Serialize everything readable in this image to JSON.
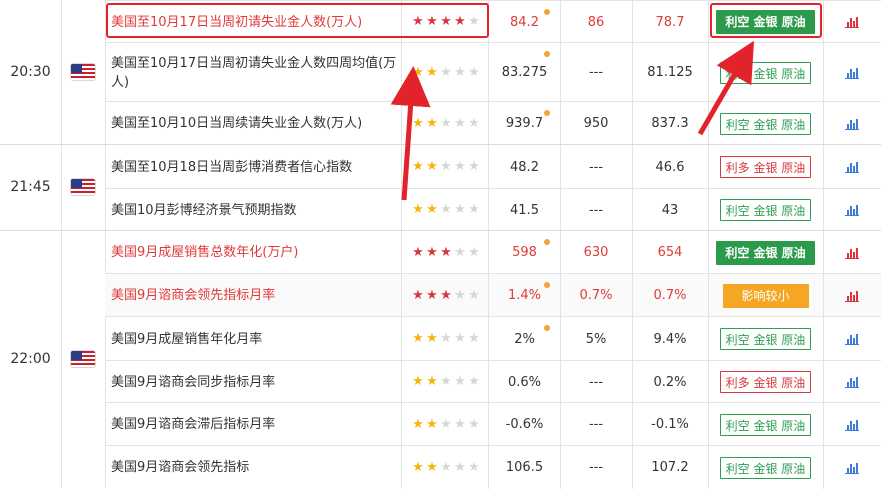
{
  "calendar": {
    "groups": [
      {
        "time": "20:30",
        "country_icon": "us-flag-icon",
        "rows": [
          {
            "name": "美国至10月17日当周初请失业金人数(万人)",
            "stars": 4,
            "star_color": "red",
            "highlight": true,
            "actual": "84.2",
            "actual_dot": true,
            "forecast": "86",
            "previous": "78.7",
            "effect": "利空 金银 原油",
            "effect_style": "green-filled",
            "chart_icon": "bar-chart-icon",
            "chart_color": "red"
          },
          {
            "name": "美国至10月17日当周初请失业金人数四周均值(万人)",
            "stars": 2,
            "star_color": "yellow",
            "highlight": false,
            "actual": "83.275",
            "actual_dot": true,
            "forecast": "---",
            "previous": "81.125",
            "effect": "利空 金银 原油",
            "effect_style": "green-outline",
            "chart_icon": "bar-chart-icon",
            "chart_color": "blue"
          },
          {
            "name": "美国至10月10日当周续请失业金人数(万人)",
            "stars": 2,
            "star_color": "yellow",
            "highlight": false,
            "actual": "939.7",
            "actual_dot": true,
            "forecast": "950",
            "previous": "837.3",
            "effect": "利空 金银 原油",
            "effect_style": "green-outline",
            "chart_icon": "bar-chart-icon",
            "chart_color": "blue"
          }
        ]
      },
      {
        "time": "21:45",
        "country_icon": "us-flag-icon",
        "rows": [
          {
            "name": "美国至10月18日当周彭博消费者信心指数",
            "stars": 2,
            "star_color": "yellow",
            "highlight": false,
            "actual": "48.2",
            "actual_dot": false,
            "forecast": "---",
            "previous": "46.6",
            "effect": "利多 金银 原油",
            "effect_style": "red-outline",
            "chart_icon": "bar-chart-icon",
            "chart_color": "blue"
          },
          {
            "name": "美国10月彭博经济景气预期指数",
            "stars": 2,
            "star_color": "yellow",
            "highlight": false,
            "actual": "41.5",
            "actual_dot": false,
            "forecast": "---",
            "previous": "43",
            "effect": "利空 金银 原油",
            "effect_style": "green-outline",
            "chart_icon": "bar-chart-icon",
            "chart_color": "blue"
          }
        ]
      },
      {
        "time": "22:00",
        "country_icon": "us-flag-icon",
        "rows": [
          {
            "name": "美国9月成屋销售总数年化(万户)",
            "stars": 3,
            "star_color": "red",
            "highlight": true,
            "actual": "598",
            "actual_dot": true,
            "forecast": "630",
            "previous": "654",
            "effect": "利空 金银 原油",
            "effect_style": "green-filled",
            "chart_icon": "bar-chart-icon",
            "chart_color": "red"
          },
          {
            "name": "美国9月谘商会领先指标月率",
            "stars": 3,
            "star_color": "red",
            "highlight": true,
            "actual": "1.4%",
            "actual_dot": true,
            "forecast": "0.7%",
            "previous": "0.7%",
            "effect": "影响较小",
            "effect_style": "orange-filled",
            "chart_icon": "bar-chart-icon",
            "chart_color": "red"
          },
          {
            "name": "美国9月成屋销售年化月率",
            "stars": 2,
            "star_color": "yellow",
            "highlight": false,
            "actual": "2%",
            "actual_dot": true,
            "forecast": "5%",
            "previous": "9.4%",
            "effect": "利空 金银 原油",
            "effect_style": "green-outline",
            "chart_icon": "bar-chart-icon",
            "chart_color": "blue"
          },
          {
            "name": "美国9月谘商会同步指标月率",
            "stars": 2,
            "star_color": "yellow",
            "highlight": false,
            "actual": "0.6%",
            "actual_dot": false,
            "forecast": "---",
            "previous": "0.2%",
            "effect": "利多 金银 原油",
            "effect_style": "red-outline",
            "chart_icon": "bar-chart-icon",
            "chart_color": "blue"
          },
          {
            "name": "美国9月谘商会滞后指标月率",
            "stars": 2,
            "star_color": "yellow",
            "highlight": false,
            "actual": "-0.6%",
            "actual_dot": false,
            "forecast": "---",
            "previous": "-0.1%",
            "effect": "利空 金银 原油",
            "effect_style": "green-outline",
            "chart_icon": "bar-chart-icon",
            "chart_color": "blue"
          },
          {
            "name": "美国9月谘商会领先指标",
            "stars": 2,
            "star_color": "yellow",
            "highlight": false,
            "actual": "106.5",
            "actual_dot": false,
            "forecast": "---",
            "previous": "107.2",
            "effect": "利空 金银 原油",
            "effect_style": "green-outline",
            "chart_icon": "bar-chart-icon",
            "chart_color": "blue"
          }
        ]
      }
    ]
  },
  "annotations": {
    "highlight_color": "#e3232c"
  }
}
